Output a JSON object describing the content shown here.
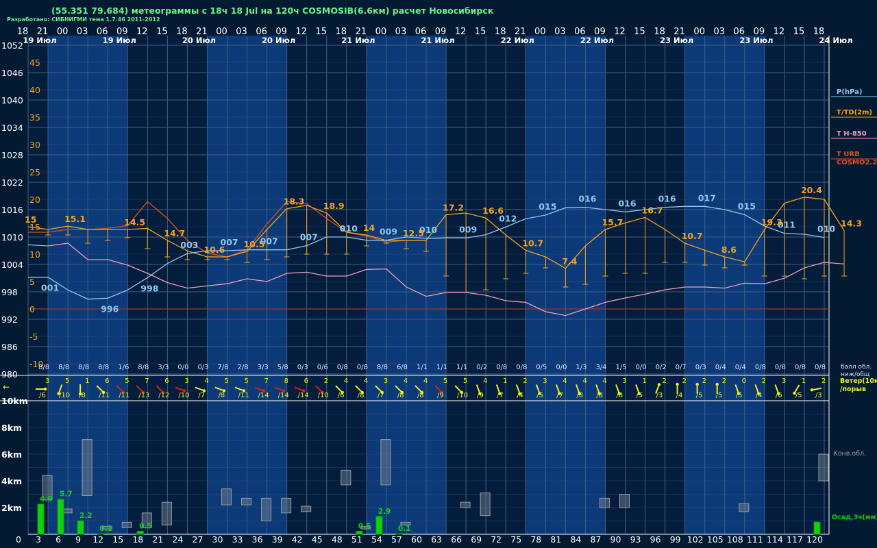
{
  "header": {
    "title": "(55.351 79.684) метеограммы с  18ч 18 Jul на 120ч COSMOSIB(6.6км) расчет Новосибирск",
    "subtitle": "Разработано: СИБНИГМИ тема 1.7.46 2011-2012"
  },
  "colors": {
    "background": "#031a33",
    "band_dark": "#041d3d",
    "band_light": "#0c3a78",
    "grid": "#3f5f86",
    "pressure": "#8ec8f0",
    "temperature": "#f5a31c",
    "dewpoint": "#e05020",
    "t850": "#f0a0b8",
    "wind": "#f0f020",
    "wind_strong": "#e02010",
    "precip": "#10d010",
    "conv": "#9a9a9a"
  },
  "chart_data": [
    {
      "type": "line",
      "name": "meteogram",
      "x_hours_labels": [
        "18",
        "21",
        "00",
        "03",
        "06",
        "09",
        "12",
        "15",
        "18",
        "21",
        "00",
        "03",
        "06",
        "09",
        "12",
        "15",
        "18",
        "21",
        "00",
        "03",
        "06",
        "09",
        "12",
        "15",
        "18",
        "21",
        "00",
        "03",
        "06",
        "09",
        "12",
        "15",
        "18",
        "21",
        "00",
        "03",
        "06",
        "09",
        "12",
        "15",
        "18"
      ],
      "day_labels": [
        {
          "text": "19 Июл",
          "step": 1
        },
        {
          "text": "19 Июл",
          "step": 5
        },
        {
          "text": "20 Июл",
          "step": 9
        },
        {
          "text": "20 Июл",
          "step": 13
        },
        {
          "text": "21 Июл",
          "step": 17
        },
        {
          "text": "21 Июл",
          "step": 21
        },
        {
          "text": "22 Июл",
          "step": 25
        },
        {
          "text": "22 Июл",
          "step": 29
        },
        {
          "text": "23 Июл",
          "step": 33
        },
        {
          "text": "23 Июл",
          "step": 37
        },
        {
          "text": "24 Июл",
          "step": 41
        }
      ],
      "pressure_axis": {
        "ticks": [
          "1052",
          "1046",
          "1040",
          "1034",
          "1028",
          "1022",
          "1016",
          "1010",
          "1004",
          "998",
          "992",
          "986",
          "980"
        ],
        "range": [
          980,
          1052
        ]
      },
      "temp_axis": {
        "ticks": [
          "45",
          "40",
          "35",
          "30",
          "25",
          "20",
          "15",
          "10",
          "5",
          "0",
          "-5",
          "-10"
        ],
        "range": [
          -12,
          48
        ]
      },
      "legend": [
        "P(hPa)",
        "T/TD(2m)",
        "T H-850",
        "T URB",
        "COSMO2.2"
      ],
      "pressure": [
        1001.2,
        1001.2,
        998.4,
        996.4,
        996.6,
        998.4,
        1001.1,
        1004.2,
        1006.4,
        1007.0,
        1007.0,
        1007.2,
        1007.2,
        1007.2,
        1008.1,
        1010.0,
        1010.0,
        1009.3,
        1009.3,
        1010.0,
        1009.7,
        1009.8,
        1009.8,
        1010.5,
        1012.2,
        1014.0,
        1014.8,
        1016.4,
        1016.5,
        1016.0,
        1015.5,
        1016.0,
        1016.5,
        1016.7,
        1016.7,
        1016.0,
        1014.9,
        1012.4,
        1010.8,
        1010.6,
        1009.9
      ],
      "pressure_labels": [
        {
          "s": 1,
          "text": "001"
        },
        {
          "s": 4,
          "text": "996"
        },
        {
          "s": 6,
          "text": "998"
        },
        {
          "s": 8,
          "text": "003"
        },
        {
          "s": 10,
          "text": "007"
        },
        {
          "s": 12,
          "text": "007"
        },
        {
          "s": 14,
          "text": "007"
        },
        {
          "s": 16,
          "text": "010"
        },
        {
          "s": 18,
          "text": "009"
        },
        {
          "s": 20,
          "text": "010"
        },
        {
          "s": 22,
          "text": "009"
        },
        {
          "s": 24,
          "text": "012"
        },
        {
          "s": 26,
          "text": "015"
        },
        {
          "s": 28,
          "text": "016"
        },
        {
          "s": 30,
          "text": "016"
        },
        {
          "s": 32,
          "text": "016"
        },
        {
          "s": 34,
          "text": "017"
        },
        {
          "s": 36,
          "text": "015"
        },
        {
          "s": 38,
          "text": "011"
        },
        {
          "s": 40,
          "text": "010"
        }
      ],
      "temperature": [
        15.0,
        14.5,
        15.1,
        14.5,
        14.5,
        14.5,
        14.7,
        12.5,
        10.6,
        9.5,
        9.5,
        10.5,
        14.5,
        18.3,
        18.9,
        17.5,
        14.0,
        13.5,
        12.5,
        12.5,
        12.5,
        17.2,
        17.5,
        16.6,
        13.5,
        10.7,
        9.5,
        7.4,
        11.5,
        14.5,
        15.7,
        16.7,
        14.5,
        12.0,
        10.7,
        9.5,
        8.6,
        14.5,
        19.3,
        20.4,
        20.0,
        14.3
      ],
      "temperature_labels": [
        {
          "s": 0,
          "text": "15"
        },
        {
          "s": 2,
          "text": "15.1"
        },
        {
          "s": 5,
          "text": "14.5"
        },
        {
          "s": 7,
          "text": "14.7"
        },
        {
          "s": 9,
          "text": "10.6"
        },
        {
          "s": 11,
          "text": "10.5"
        },
        {
          "s": 13,
          "text": "18.3"
        },
        {
          "s": 15,
          "text": "18.9"
        },
        {
          "s": 17,
          "text": "14"
        },
        {
          "s": 19,
          "text": "12.5"
        },
        {
          "s": 21,
          "text": "17.2"
        },
        {
          "s": 23,
          "text": "16.6"
        },
        {
          "s": 25,
          "text": "10.7"
        },
        {
          "s": 27,
          "text": "7.4"
        },
        {
          "s": 29,
          "text": "15.7"
        },
        {
          "s": 31,
          "text": "16.7"
        },
        {
          "s": 33,
          "text": "10.7"
        },
        {
          "s": 35,
          "text": "8.6"
        },
        {
          "s": 37,
          "text": "19.3"
        },
        {
          "s": 39,
          "text": "20.4"
        },
        {
          "s": 41,
          "text": "14.3"
        }
      ],
      "dewpoint": [
        14.0,
        14.0,
        14.5,
        14.5,
        14.7,
        15.2,
        19.6,
        16.5,
        12.5,
        10.2,
        9.5,
        10.8,
        15.5,
        19.6,
        19.2,
        16.5,
        14.0,
        13.3,
        12.2,
        12.5,
        12.5
      ],
      "dewpoint_bars": [
        13.0,
        13.5,
        13.5,
        12.0,
        12.5,
        13.0,
        11.0,
        9.5,
        9.0,
        9.0,
        9.0,
        8.5,
        9.0,
        9.5,
        10.0,
        10.0,
        10.0,
        11.5,
        12.0,
        11.0,
        10.5,
        6.0,
        3.0,
        3.5,
        5.5,
        6.5,
        7.5,
        4.0,
        4.5,
        6.0,
        6.5,
        6.5,
        8.5,
        8.5,
        8.0,
        7.5,
        8.0,
        6.0,
        6.0,
        5.5,
        6.0,
        6.0
      ],
      "t850": [
        11.7,
        11.5,
        12.0,
        9.0,
        9.0,
        8.0,
        6.5,
        4.8,
        3.8,
        4.2,
        4.6,
        5.5,
        5.0,
        6.5,
        6.7,
        6.0,
        6.0,
        7.2,
        7.3,
        4.0,
        2.3,
        3.0,
        3.0,
        2.5,
        1.5,
        1.2,
        -0.5,
        -1.2,
        0.0,
        1.2,
        2.0,
        2.7,
        3.5,
        4.0,
        4.0,
        3.8,
        4.7,
        4.6,
        5.6,
        7.5,
        8.5,
        8.2
      ],
      "zero_line_temp": 0,
      "cloud_label": "балл обл. ниж/общ",
      "cloud_cover": [
        "8/8",
        "8/8",
        "8/8",
        "8/8",
        "1/6",
        "8/8",
        "3/3",
        "0/0",
        "0/3",
        "7/8",
        "2/8",
        "3/3",
        "5/8",
        "0/3",
        "0/6",
        "0/8",
        "0/8",
        "8/8",
        "6/8",
        "1/1",
        "1/1",
        "1/1",
        "0/2",
        "0/8",
        "0/8",
        "0/5",
        "0/0",
        "1/3",
        "3/4",
        "1/5",
        "0/0",
        "0/2",
        "0/7",
        "0/3",
        "0/4",
        "0/4",
        "0/8",
        "0/8",
        "0/8",
        "0/8"
      ]
    },
    {
      "type": "scatter",
      "name": "wind",
      "legend": [
        "Ветер(10м)",
        "/порыв"
      ],
      "wind_speed": [
        "3",
        "5",
        "1",
        "6",
        "5",
        "7",
        "6",
        "3",
        "4",
        "5",
        "5",
        "7",
        "8",
        "6",
        "2",
        "4",
        "4",
        "3",
        "4",
        "4",
        "5",
        "5",
        "4",
        "1",
        "2",
        "3",
        "4",
        "4",
        "4",
        "3",
        "1",
        "2",
        "2",
        "2",
        "2",
        "0",
        "2",
        "3",
        "1",
        "2"
      ],
      "wind_gust": [
        "/6",
        "/10",
        "/8",
        "/11",
        "/11",
        "/13",
        "/12",
        "/10",
        "/7",
        "/8",
        "/11",
        "/14",
        "/14",
        "/14",
        "/10",
        "/6",
        "/8",
        "/7",
        "/8",
        "/8",
        "/9",
        "/10",
        "/9",
        "/7",
        "/4",
        "/5",
        "/7",
        "/8",
        "/8",
        "/8",
        "/5",
        "/3",
        "/4",
        "/5",
        "/5",
        "/5",
        "/4",
        "/6",
        "/5",
        "/3"
      ],
      "wind_dir_deg": [
        90,
        200,
        180,
        135,
        135,
        135,
        135,
        110,
        110,
        110,
        110,
        110,
        110,
        110,
        135,
        135,
        135,
        135,
        135,
        135,
        135,
        135,
        160,
        160,
        160,
        160,
        160,
        160,
        160,
        160,
        160,
        20,
        0,
        0,
        0,
        160,
        160,
        160,
        210,
        260
      ],
      "wind_strong_steps": [
        4,
        5,
        6,
        7,
        11,
        12,
        13,
        14,
        20
      ]
    },
    {
      "type": "bar",
      "name": "precip_clouds",
      "x_hour_ticks": [
        "0",
        "3",
        "6",
        "9",
        "12",
        "15",
        "18",
        "21",
        "24",
        "27",
        "30",
        "33",
        "36",
        "39",
        "42",
        "45",
        "48",
        "51",
        "54",
        "57",
        "60",
        "63",
        "66",
        "69",
        "72",
        "75",
        "78",
        "81",
        "84",
        "87",
        "90",
        "93",
        "96",
        "99",
        "102",
        "105",
        "108",
        "111",
        "114",
        "117",
        "120"
      ],
      "height_ticks": [
        "10km",
        "8km",
        "6km",
        "4km",
        "2km"
      ],
      "height_range_km": [
        0,
        10.5
      ],
      "legend": [
        "Конв.обл.",
        "Осад,3ч(мм)"
      ],
      "precip_values": [
        {
          "s": 1,
          "v": 4.9,
          "text": "4.9"
        },
        {
          "s": 2,
          "v": 5.7,
          "text": "5.7"
        },
        {
          "s": 3,
          "v": 2.2,
          "text": "2.2"
        },
        {
          "s": 4,
          "v": 0.1,
          "text": "0.1"
        },
        {
          "s": 6,
          "v": 0.5,
          "text": "0.5"
        },
        {
          "s": 17,
          "v": 0.5,
          "text": "0.5"
        },
        {
          "s": 18,
          "v": 2.9,
          "text": "2.9"
        },
        {
          "s": 19,
          "v": 0.1,
          "text": "0.1"
        },
        {
          "s": 40,
          "v": 2.0,
          "text": ""
        }
      ],
      "conv_clouds_km": [
        {
          "s": 1,
          "bot": 2.6,
          "top": 4.4
        },
        {
          "s": 2,
          "bot": 1.6,
          "top": 1.9
        },
        {
          "s": 3,
          "bot": 2.9,
          "top": 7.1
        },
        {
          "s": 4,
          "bot": 0.4,
          "top": 0.6
        },
        {
          "s": 5,
          "bot": 0.5,
          "top": 0.9
        },
        {
          "s": 6,
          "bot": 0.5,
          "top": 1.6
        },
        {
          "s": 7,
          "bot": 0.7,
          "top": 2.4
        },
        {
          "s": 10,
          "bot": 2.2,
          "top": 3.4
        },
        {
          "s": 11,
          "bot": 2.2,
          "top": 2.7
        },
        {
          "s": 12,
          "bot": 1.0,
          "top": 2.7
        },
        {
          "s": 13,
          "bot": 1.6,
          "top": 2.7
        },
        {
          "s": 14,
          "bot": 1.7,
          "top": 2.1
        },
        {
          "s": 16,
          "bot": 3.7,
          "top": 4.8
        },
        {
          "s": 17,
          "bot": 0.4,
          "top": 0.6
        },
        {
          "s": 18,
          "bot": 3.7,
          "top": 7.1
        },
        {
          "s": 19,
          "bot": 0.7,
          "top": 0.9
        },
        {
          "s": 22,
          "bot": 2.0,
          "top": 2.4
        },
        {
          "s": 23,
          "bot": 1.4,
          "top": 3.1
        },
        {
          "s": 29,
          "bot": 2.0,
          "top": 2.7
        },
        {
          "s": 30,
          "bot": 2.0,
          "top": 3.0
        },
        {
          "s": 36,
          "bot": 1.7,
          "top": 2.3
        },
        {
          "s": 40,
          "bot": 4.0,
          "top": 6.0
        }
      ]
    }
  ]
}
